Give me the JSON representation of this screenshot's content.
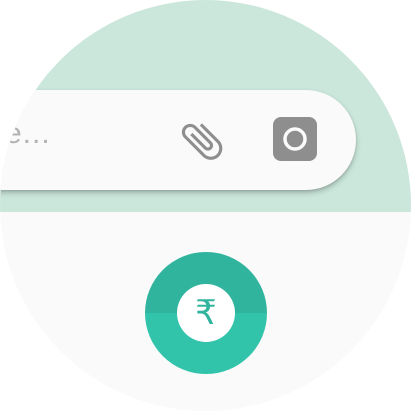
{
  "input_bar": {
    "placeholder": "e...",
    "attach_icon": "paperclip-icon",
    "camera_icon": "camera-icon"
  },
  "pay_button": {
    "icon": "rupee-icon",
    "symbol": "₹"
  },
  "colors": {
    "top_background": "#cbe7db",
    "bottom_background": "#fafafa",
    "input_background": "#fafafa",
    "placeholder_text": "#b3b3b3",
    "icon_grey": "#8e8e8e",
    "accent_teal": "#31b49d"
  }
}
